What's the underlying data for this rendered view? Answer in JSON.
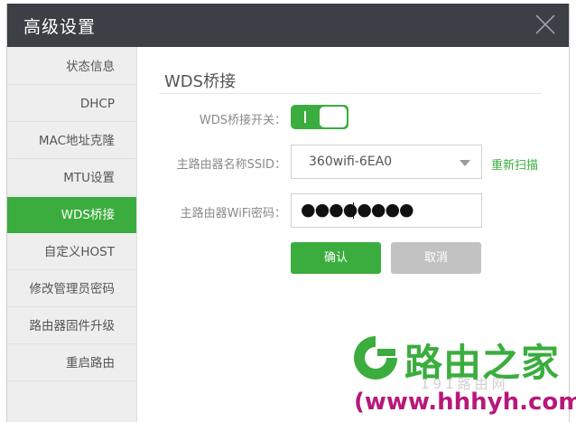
{
  "window": {
    "title": "高级设置"
  },
  "sidebar": {
    "items": [
      {
        "label": "状态信息",
        "active": false
      },
      {
        "label": "DHCP",
        "active": false
      },
      {
        "label": "MAC地址克隆",
        "active": false
      },
      {
        "label": "MTU设置",
        "active": false
      },
      {
        "label": "WDS桥接",
        "active": true
      },
      {
        "label": "自定义HOST",
        "active": false
      },
      {
        "label": "修改管理员密码",
        "active": false
      },
      {
        "label": "路由器固件升级",
        "active": false
      },
      {
        "label": "重启路由",
        "active": false
      }
    ]
  },
  "content": {
    "title": "WDS桥接",
    "switch": {
      "label": "WDS桥接开关：",
      "state": "on"
    },
    "ssid": {
      "label": "主路由器名称SSID：",
      "value": "360wifi-6EA0"
    },
    "rescan_label": "重新扫描",
    "password": {
      "label": "主路由器WiFi密码：",
      "value": "●●●●●●●●"
    },
    "confirm_label": "确认",
    "cancel_label": "取消"
  },
  "watermark": {
    "brand": "路由之家",
    "subtitle": "191路由网",
    "url": "(www.hhhyh.com)"
  },
  "colors": {
    "accent": "#3bad3e",
    "titlebar": "#3c3f45",
    "sidebar": "#eeeeee",
    "cancel": "#c2c2c2",
    "url": "#b7197a"
  }
}
